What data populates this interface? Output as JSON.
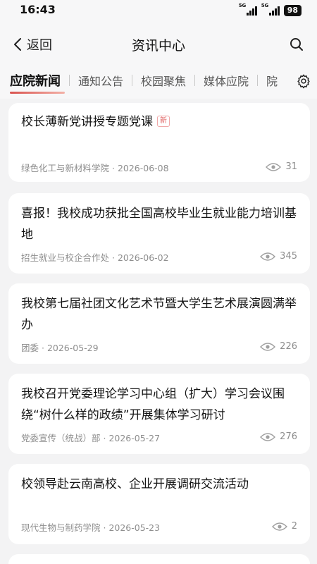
{
  "status": {
    "time": "16:43",
    "net1": "5G",
    "net2": "5G",
    "battery": "98"
  },
  "header": {
    "back_label": "返回",
    "title": "资讯中心"
  },
  "tabs": [
    {
      "label": "应院新闻",
      "active": true
    },
    {
      "label": "通知公告"
    },
    {
      "label": "校园聚焦"
    },
    {
      "label": "媒体应院"
    },
    {
      "label": "院"
    }
  ],
  "news": [
    {
      "title": "校长薄新党讲授专题党课",
      "badge": "新",
      "source": "绿色化工与新材料学院",
      "date": "2026-06-08",
      "views": "31"
    },
    {
      "title": "喜报！我校成功获批全国高校毕业生就业能力培训基地",
      "source": "招生就业与校企合作处",
      "date": "2026-06-02",
      "views": "345"
    },
    {
      "title": "我校第七届社团文化艺术节暨大学生艺术展演圆满举办",
      "source": "团委",
      "date": "2026-05-29",
      "views": "226"
    },
    {
      "title": "我校召开党委理论学习中心组（扩大）学习会议围绕“树什么样的政绩”开展集体学习研讨",
      "source": "党委宣传（统战）部",
      "date": "2026-05-27",
      "views": "276"
    },
    {
      "title": "校领导赴云南高校、企业开展调研交流活动",
      "source": "现代生物与制药学院",
      "date": "2026-05-23",
      "views": "2"
    }
  ],
  "colors": {
    "accent": "#d9534f",
    "background": "#f3f3f4",
    "card": "#ffffff"
  }
}
